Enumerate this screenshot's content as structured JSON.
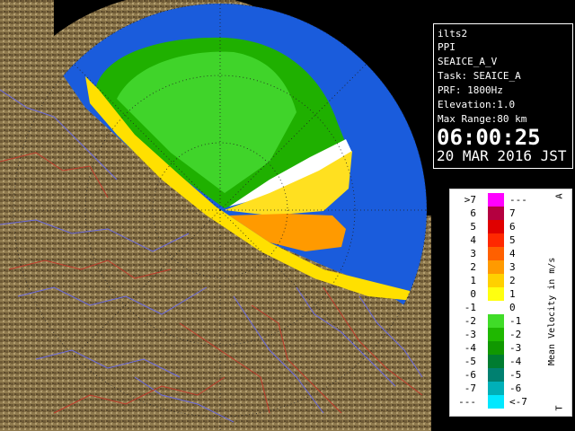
{
  "info": {
    "site": "ilts2",
    "scan_type": "PPI",
    "product": "SEAICE_A_V",
    "task": "Task: SEAICE_A",
    "prf": "PRF: 1800Hz",
    "elevation": "Elevation:1.0",
    "max_range": "Max Range:80 km",
    "time": "06:00:25",
    "date": "20 MAR 2016 JST"
  },
  "legend": {
    "title": "Mean Velocity in m/s",
    "top_marker": "A",
    "bottom_marker": "T",
    "rows": [
      {
        "left": ">7",
        "right": "---",
        "color": "#ff00ff"
      },
      {
        "left": "6",
        "right": "7",
        "color": "#b40040"
      },
      {
        "left": "5",
        "right": "6",
        "color": "#e00000"
      },
      {
        "left": "4",
        "right": "5",
        "color": "#ff2800"
      },
      {
        "left": "3",
        "right": "4",
        "color": "#ff6000"
      },
      {
        "left": "2",
        "right": "3",
        "color": "#ff9a00"
      },
      {
        "left": "1",
        "right": "2",
        "color": "#ffd000"
      },
      {
        "left": "0",
        "right": "1",
        "color": "#ffff10"
      },
      {
        "left": "-1",
        "right": "0",
        "color": "#ffffff"
      },
      {
        "left": "-2",
        "right": "-1",
        "color": "#40dc28"
      },
      {
        "left": "-3",
        "right": "-2",
        "color": "#1fb800"
      },
      {
        "left": "-4",
        "right": "-3",
        "color": "#109800"
      },
      {
        "left": "-5",
        "right": "-4",
        "color": "#007c30"
      },
      {
        "left": "-6",
        "right": "-5",
        "color": "#008070"
      },
      {
        "left": "-7",
        "right": "-6",
        "color": "#00b0b8"
      },
      {
        "left": "---",
        "right": "<-7",
        "color": "#00e8ff"
      }
    ]
  },
  "colors": {
    "range_background": "#1a5cdc",
    "land": "#8a7448",
    "rivers": "#6a6ae0",
    "boundaries": "#c23a2a"
  }
}
